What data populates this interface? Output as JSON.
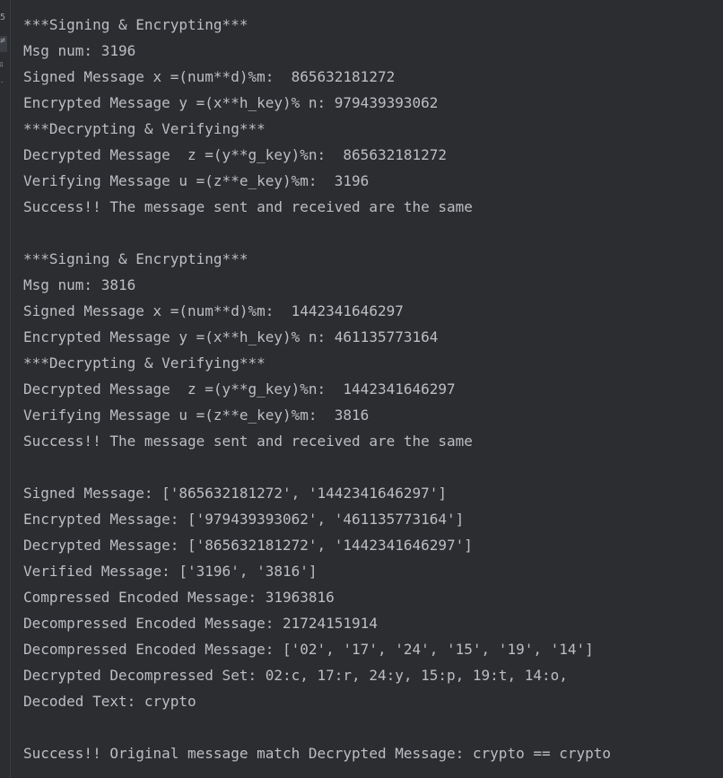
{
  "gutter": {
    "marks": [
      "5",
      "≠",
      "ﾛ",
      "·"
    ]
  },
  "console": {
    "lines": [
      "***Signing & Encrypting***",
      "Msg num: 3196",
      "Signed Message x =(num**d)%m:  865632181272",
      "Encrypted Message y =(x**h_key)% n: 979439393062",
      "***Decrypting & Verifying***",
      "Decrypted Message  z =(y**g_key)%n:  865632181272",
      "Verifying Message u =(z**e_key)%m:  3196",
      "Success!! The message sent and received are the same",
      "",
      "***Signing & Encrypting***",
      "Msg num: 3816",
      "Signed Message x =(num**d)%m:  1442341646297",
      "Encrypted Message y =(x**h_key)% n: 461135773164",
      "***Decrypting & Verifying***",
      "Decrypted Message  z =(y**g_key)%n:  1442341646297",
      "Verifying Message u =(z**e_key)%m:  3816",
      "Success!! The message sent and received are the same",
      "",
      "Signed Message: ['865632181272', '1442341646297']",
      "Encrypted Message: ['979439393062', '461135773164']",
      "Decrypted Message: ['865632181272', '1442341646297']",
      "Verified Message: ['3196', '3816']",
      "Compressed Encoded Message: 31963816",
      "Decompressed Encoded Message: 21724151914",
      "Decompressed Encoded Message: ['02', '17', '24', '15', '19', '14']",
      "Decrypted Decompressed Set: 02:c, 17:r, 24:y, 15:p, 19:t, 14:o,",
      "Decoded Text: crypto",
      "",
      "Success!! Original message match Decrypted Message: crypto == crypto"
    ]
  }
}
